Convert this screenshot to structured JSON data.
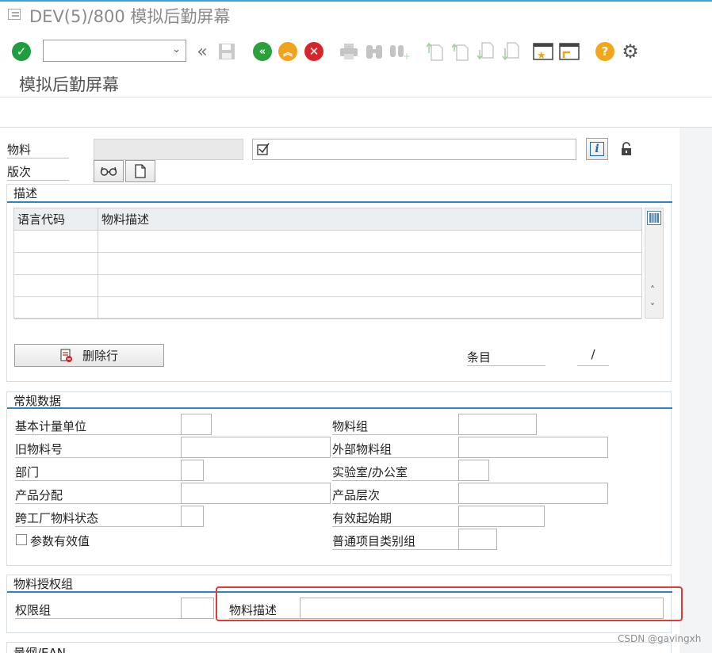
{
  "window": {
    "title": "DEV(5)/800 模拟后勤屏幕"
  },
  "toolbar": {
    "command_field_value": "",
    "icons": [
      "enter-check-icon",
      "collapse-icon",
      "save-icon",
      "back-icon",
      "exit-icon",
      "cancel-icon",
      "print-icon",
      "find-icon",
      "find-next-icon",
      "first-page-icon",
      "prev-page-icon",
      "next-page-icon",
      "last-page-icon",
      "create-session-icon",
      "shortcut-icon",
      "help-icon",
      "settings-icon"
    ]
  },
  "screen": {
    "title": "模拟后勤屏幕"
  },
  "header": {
    "material_label": "物料",
    "version_label": "版次",
    "material_value": "",
    "material_desc_value": ""
  },
  "description": {
    "group_title": "描述",
    "columns": [
      "语言代码",
      "物料描述"
    ],
    "rows": [
      [
        "",
        ""
      ],
      [
        "",
        ""
      ],
      [
        "",
        ""
      ],
      [
        "",
        ""
      ]
    ],
    "delete_row_label": "删除行",
    "entries_label": "条目",
    "entries_value": "/"
  },
  "general": {
    "group_title": "常规数据",
    "base_uom": "基本计量单位",
    "old_material": "旧物料号",
    "division": "部门",
    "product_allocation": "产品分配",
    "cross_plant_status": "跨工厂物料状态",
    "param_effectivity": "参数有效值",
    "material_group": "物料组",
    "ext_material_group": "外部物料组",
    "lab_office": "实验室/办公室",
    "product_hierarchy": "产品层次",
    "valid_from": "有效起始期",
    "gen_item_cat_group": "普通项目类别组"
  },
  "authorization": {
    "group_title": "物料授权组",
    "auth_group_label": "权限组",
    "material_desc_label": "物料描述",
    "material_desc_value": ""
  },
  "dimensions": {
    "group_title": "量纲/EAN"
  },
  "watermark": "CSDN @gavingxh",
  "colors": {
    "accent": "#2e86c1",
    "highlight": "#e53935",
    "check": "#1e9e3e",
    "back": "#2aa13a",
    "exit": "#f0a31c",
    "cancel": "#d7262b",
    "help": "#f2a71b"
  }
}
